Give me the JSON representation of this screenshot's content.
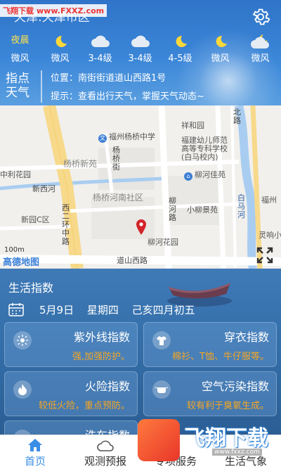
{
  "watermark_top": {
    "brand": "飞翔下载",
    "url": "www.FXXZ.com"
  },
  "header": {
    "city": "天津:天津市区"
  },
  "forecast": [
    {
      "period": "夜晨",
      "icon": "moon-icon",
      "wind": "微风"
    },
    {
      "period": "",
      "icon": "moon-icon",
      "wind": "微风"
    },
    {
      "period": "",
      "icon": "cloud-icon",
      "wind": "3-4级"
    },
    {
      "period": "",
      "icon": "cloud-icon",
      "wind": "3-4级"
    },
    {
      "period": "",
      "icon": "moon-icon",
      "wind": "4-5级"
    },
    {
      "period": "",
      "icon": "moon-icon",
      "wind": "微风"
    },
    {
      "period": "",
      "icon": "moon-cloud-icon",
      "wind": "微风"
    }
  ],
  "pinpoint": {
    "label": "指点天气",
    "label_line1": "指点",
    "label_line2": "天气",
    "location": "位置：南街街道道山西路1号",
    "tip": "提示：查看出行天气，掌握天气动态~"
  },
  "map": {
    "labels": {
      "xingzhong": "福州杨桥中学",
      "xianghe": "祥和园",
      "youshi": "福建幼儿师范高等专科学校(白马校内)",
      "youshi_1": "福建幼儿师范",
      "youshi_2": "高等专科学校",
      "youshi_3": "(白马校内)",
      "ylf": "杨桥新苑",
      "lihuayuan": "中利花园",
      "liuhejia": "柳河佳苑",
      "xinxi": "新西河",
      "yqhn": "杨桥河南社区",
      "xiaoliu": "小柳景苑",
      "xinyuan": "新园C区",
      "liuhehy": "柳河花园",
      "daoshan": "道山西路",
      "xierhuan": "西二环中路",
      "yangqiaojie": "杨桥街",
      "liuhelu": "柳河路",
      "baimahe": "白马河",
      "fuzhou": "福州",
      "lingling": "灵响小",
      "beilu": "北路",
      "scale": "100m",
      "brand": "高德地图"
    }
  },
  "life": {
    "title": "生活指数",
    "date": {
      "day": "5月9日",
      "weekday": "星期四",
      "lunar": "己亥四月初五"
    },
    "cards": [
      {
        "title": "紫外线指数",
        "desc": "强,加强防护。",
        "icon": "sun-icon"
      },
      {
        "title": "穿衣指数",
        "desc": "棉衫、T恤、牛仔服等。",
        "icon": "shirt-icon"
      },
      {
        "title": "火险指数",
        "desc": "较低火险，重点预防。",
        "icon": "fire-icon"
      },
      {
        "title": "空气污染指数",
        "desc": "较有利于臭氧生成。",
        "icon": "mask-icon"
      },
      {
        "title": "洗车指数",
        "desc": "",
        "icon": "car-icon"
      }
    ]
  },
  "nav": [
    {
      "label": "首页",
      "icon": "home-icon",
      "active": true
    },
    {
      "label": "观测预报",
      "icon": "cloud-icon",
      "active": false
    },
    {
      "label": "专项服务",
      "icon": "service-icon",
      "active": false
    },
    {
      "label": "生活气象",
      "icon": "life-icon",
      "active": false
    }
  ],
  "watermark_bottom": {
    "brand": "飞翔下载",
    "url": "www.fxxz.com"
  },
  "colors": {
    "header": "#2f74c8",
    "accent": "#f5a623",
    "nav_active": "#3a8ee6",
    "period": "#ffe34d"
  }
}
